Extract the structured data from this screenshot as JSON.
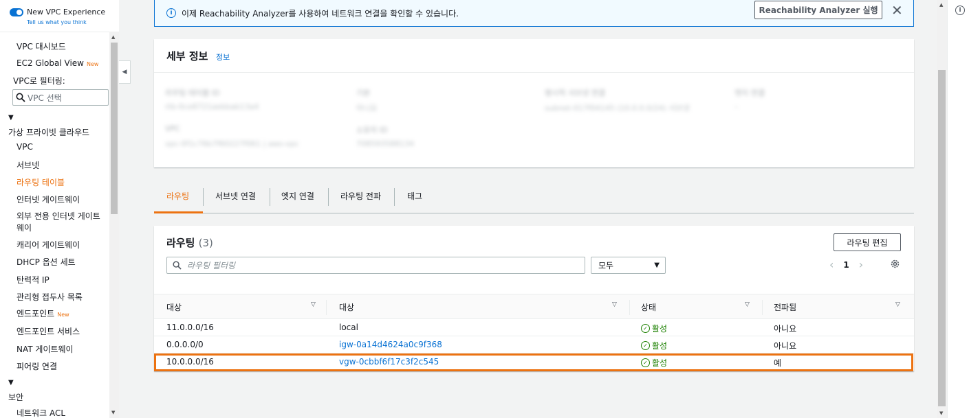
{
  "sidebar": {
    "toggle_label": "New VPC Experience",
    "toggle_sub": "Tell us what you think",
    "dashboard": "VPC 대시보드",
    "global_view": "EC2 Global View",
    "new_badge": "New",
    "filter_label": "VPC로 필터링:",
    "filter_placeholder": "VPC 선택",
    "section_vpc": "가상 프라이빗 클라우드",
    "items": [
      {
        "label": "VPC"
      },
      {
        "label": "서브넷"
      },
      {
        "label": "라우팅 테이블"
      },
      {
        "label": "인터넷 게이트웨이"
      },
      {
        "label": "외부 전용 인터넷 게이트"
      },
      {
        "label": "웨이"
      },
      {
        "label": "캐리어 게이트웨이"
      },
      {
        "label": "DHCP 옵션 세트"
      },
      {
        "label": "탄력적 IP"
      },
      {
        "label": "관리형 접두사 목록"
      },
      {
        "label": "엔드포인트"
      },
      {
        "label": "엔드포인트 서비스"
      },
      {
        "label": "NAT 게이트웨이"
      },
      {
        "label": "피어링 연결"
      }
    ],
    "section_security": "보안",
    "security_items": [
      {
        "label": "네트워크 ACL"
      }
    ]
  },
  "banner": {
    "message": "이제 Reachability Analyzer를 사용하여 네트워크 연결을 확인할 수 있습니다.",
    "button": "Reachability Analyzer 실행"
  },
  "details": {
    "title": "세부 정보",
    "info_link": "정보",
    "blurred_fields": [
      {
        "label": "라우팅 테이블 ID",
        "value": "rtb-0ce8721aebbab13a4"
      },
      {
        "label": "기본",
        "value": "아니요"
      },
      {
        "label": "명시적 서브넷 연결",
        "value": "subnet-017f04145 (10.0.0.0/24) 서브넷"
      },
      {
        "label": "엣지 연결",
        "value": "–"
      },
      {
        "label": "VPC",
        "value": "vpc-0f1c76b7f60227f061 | aws-vpc"
      },
      {
        "label": "소유자 ID",
        "value": "708593588134"
      }
    ]
  },
  "tabs": [
    {
      "label": "라우팅"
    },
    {
      "label": "서브넷 연결"
    },
    {
      "label": "엣지 연결"
    },
    {
      "label": "라우팅 전파"
    },
    {
      "label": "태그"
    }
  ],
  "routes": {
    "title": "라우팅",
    "count": "(3)",
    "edit_button": "라우팅 편집",
    "filter_placeholder": "라우팅 필터링",
    "select_value": "모두",
    "page": "1",
    "columns": [
      "대상",
      "대상",
      "상태",
      "전파됨"
    ],
    "rows": [
      {
        "destination": "11.0.0.0/16",
        "target": "local",
        "status": "활성",
        "propagated": "아니요"
      },
      {
        "destination": "0.0.0.0/0",
        "target": "igw-0a14d4624a0c9f368",
        "status": "활성",
        "propagated": "아니요"
      },
      {
        "destination": "10.0.0.0/16",
        "target": "vgw-0cbbf6f17c3f2c545",
        "status": "활성",
        "propagated": "예"
      }
    ]
  },
  "colors": {
    "accent_orange": "#ec7211",
    "link_blue": "#0972d3",
    "status_green": "#1d8102"
  }
}
